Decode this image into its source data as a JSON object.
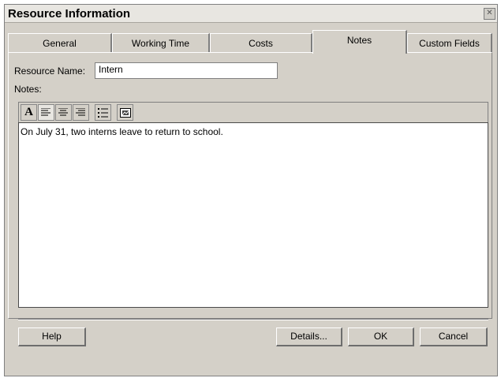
{
  "window": {
    "title": "Resource Information"
  },
  "tabs": [
    {
      "label": "General"
    },
    {
      "label": "Working Time"
    },
    {
      "label": "Costs"
    },
    {
      "label": "Notes"
    },
    {
      "label": "Custom Fields"
    }
  ],
  "form": {
    "resource_name_label": "Resource Name:",
    "resource_name_value": "Intern",
    "notes_label": "Notes:"
  },
  "toolbar": {
    "buttons": [
      "font-icon",
      "align-left-icon",
      "align-center-icon",
      "align-right-icon",
      "bullets-icon",
      "insert-object-icon"
    ],
    "font_glyph": "A"
  },
  "notes": {
    "text": "On July 31, two interns leave to return to school."
  },
  "footer": {
    "help_label": "Help",
    "details_label": "Details...",
    "ok_label": "OK",
    "cancel_label": "Cancel"
  }
}
